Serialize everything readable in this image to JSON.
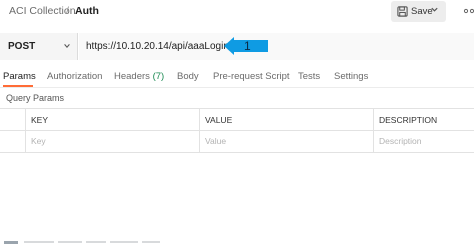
{
  "breadcrumb": {
    "parent": "ACI Collection",
    "separator": "/",
    "current": "Auth"
  },
  "toolbar": {
    "save_label": "Save",
    "save_icon": "save-icon",
    "save_dropdown_icon": "chevron-down-icon",
    "more_icon": "more-icon"
  },
  "request": {
    "method": "POST",
    "url": "https://10.10.20.14/api/aaaLogin.json"
  },
  "annotation": {
    "label": "1",
    "color": "#0f9be3"
  },
  "tabs": [
    {
      "label": "Params",
      "active": true
    },
    {
      "label": "Authorization"
    },
    {
      "label": "Headers",
      "count": "(7)"
    },
    {
      "label": "Body"
    },
    {
      "label": "Pre-request Script"
    },
    {
      "label": "Tests"
    },
    {
      "label": "Settings"
    }
  ],
  "query_params": {
    "title": "Query Params",
    "columns": [
      "KEY",
      "VALUE",
      "DESCRIPTION"
    ],
    "placeholders": [
      "Key",
      "Value",
      "Description"
    ]
  },
  "colors": {
    "accent": "#ff6c37",
    "count": "#1a8a52",
    "callout": "#0f9be3"
  }
}
